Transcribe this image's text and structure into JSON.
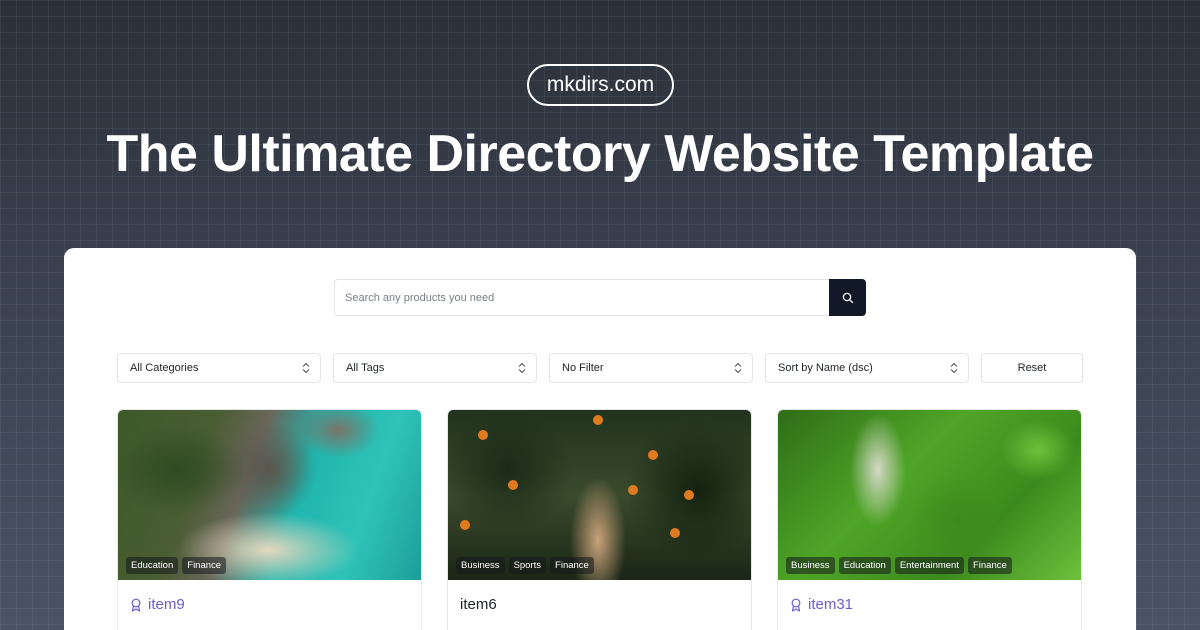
{
  "brand": "mkdirs.com",
  "headline": "The Ultimate Directory Website Template",
  "search": {
    "placeholder": "Search any products you need"
  },
  "filters": {
    "category": "All Categories",
    "tags": "All Tags",
    "filter": "No Filter",
    "sort": "Sort by Name (dsc)",
    "reset": "Reset"
  },
  "items": [
    {
      "title": "item9",
      "featured": true,
      "tags": [
        "Education",
        "Finance"
      ]
    },
    {
      "title": "item6",
      "featured": false,
      "tags": [
        "Business",
        "Sports",
        "Finance"
      ]
    },
    {
      "title": "item31",
      "featured": true,
      "tags": [
        "Business",
        "Education",
        "Entertainment",
        "Finance"
      ]
    }
  ],
  "colors": {
    "accent": "#6d5bd0",
    "dark": "#111827"
  }
}
